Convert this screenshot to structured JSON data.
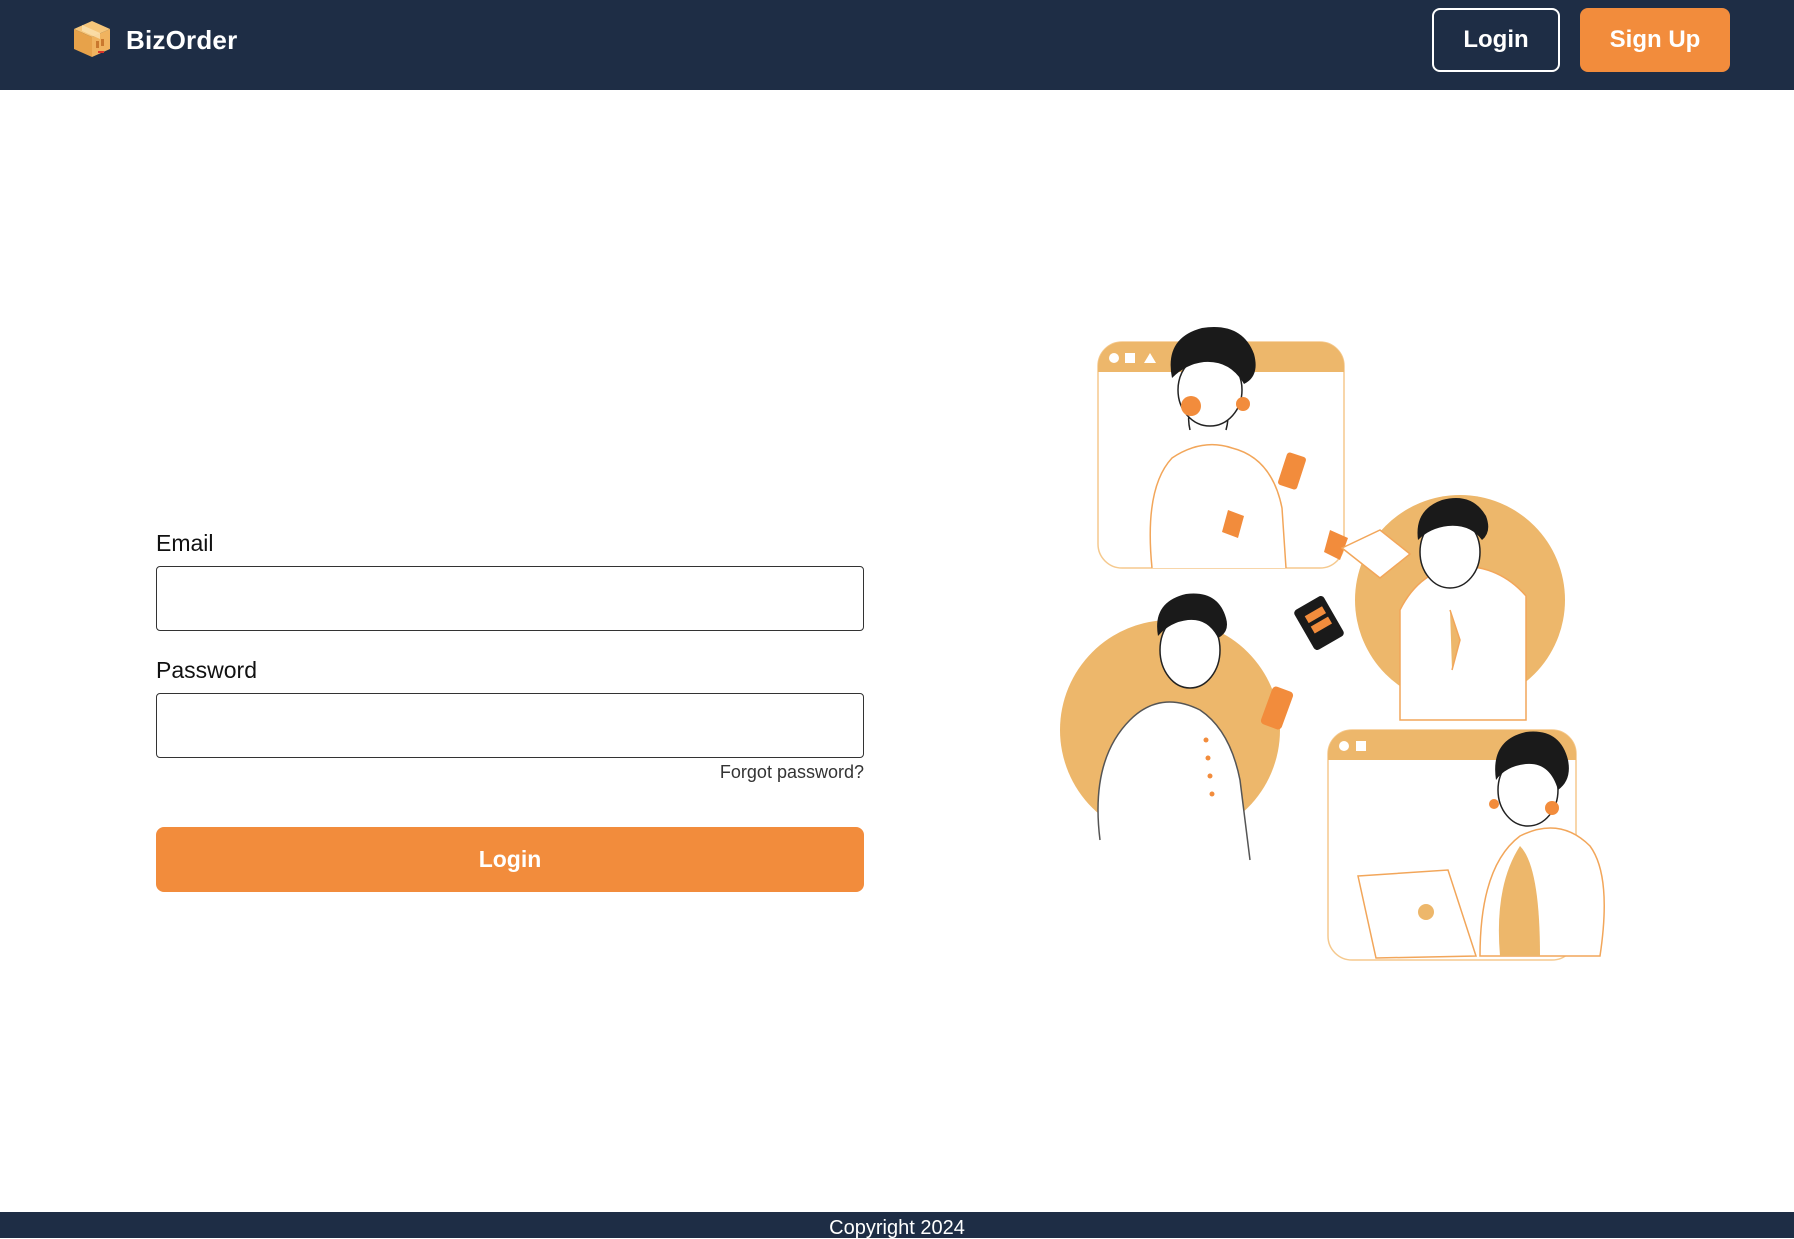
{
  "header": {
    "brand_name": "BizOrder",
    "logo_icon": "package-box-icon",
    "login_label": "Login",
    "signup_label": "Sign Up"
  },
  "form": {
    "email_label": "Email",
    "email_value": "",
    "password_label": "Password",
    "password_value": "",
    "forgot_label": "Forgot password?",
    "submit_label": "Login"
  },
  "illustration": {
    "icon": "people-ordering-online-illustration"
  },
  "footer": {
    "copyright": "Copyright 2024"
  },
  "colors": {
    "navbar": "#1e2d45",
    "accent": "#f28c3c",
    "illustration_fill": "#edb76b"
  }
}
